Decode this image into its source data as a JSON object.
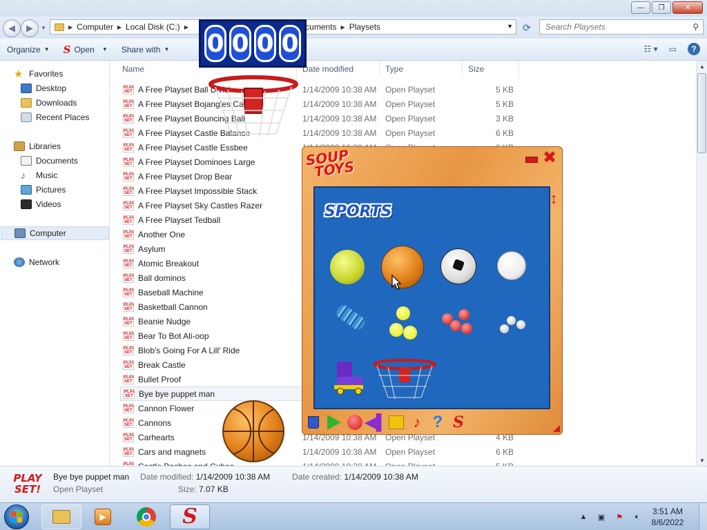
{
  "window": {
    "minimize_glyph": "—",
    "maximize_glyph": "❐",
    "close_glyph": "✕"
  },
  "address": {
    "back_glyph": "◀",
    "forward_glyph": "▶",
    "crumbs": [
      "Computer",
      "Local Disk (C:)",
      "Documents",
      "Playsets"
    ],
    "search_placeholder": "Search Playsets"
  },
  "toolbar": {
    "organize": "Organize",
    "open": "Open",
    "share_with": "Share with"
  },
  "nav": {
    "favorites": "Favorites",
    "desktop": "Desktop",
    "downloads": "Downloads",
    "recent_places": "Recent Places",
    "libraries": "Libraries",
    "documents": "Documents",
    "music": "Music",
    "pictures": "Pictures",
    "videos": "Videos",
    "computer": "Computer",
    "network": "Network"
  },
  "columns": {
    "name": "Name",
    "date": "Date modified",
    "type": "Type",
    "size": "Size"
  },
  "files": [
    {
      "name": "A Free Playset Ball Divisi",
      "date": "1/14/2009 10:38 AM",
      "type": "Open Playset",
      "size": "5 KB"
    },
    {
      "name": "A Free Playset Bojangles Castle",
      "date": "1/14/2009 10:38 AM",
      "type": "Open Playset",
      "size": "5 KB"
    },
    {
      "name": "A Free Playset Bouncing Ball",
      "date": "1/14/2009 10:38 AM",
      "type": "Open Playset",
      "size": "3 KB"
    },
    {
      "name": "A Free Playset Castle Balance",
      "date": "1/14/2009 10:38 AM",
      "type": "Open Playset",
      "size": "6 KB"
    },
    {
      "name": "A Free Playset Castle Essbee",
      "date": "1/14/2009 10:38 AM",
      "type": "Open Playset",
      "size": "6 KB"
    },
    {
      "name": "A Free Playset Dominoes Large",
      "date": "",
      "type": "",
      "size": ""
    },
    {
      "name": "A Free Playset Drop Bear",
      "date": "",
      "type": "",
      "size": ""
    },
    {
      "name": "A Free Playset Impossible Stack",
      "date": "",
      "type": "",
      "size": ""
    },
    {
      "name": "A Free Playset Sky Castles Razer",
      "date": "",
      "type": "",
      "size": ""
    },
    {
      "name": "A Free Playset Tedball",
      "date": "",
      "type": "",
      "size": ""
    },
    {
      "name": "Another One",
      "date": "",
      "type": "",
      "size": ""
    },
    {
      "name": "Asylum",
      "date": "",
      "type": "",
      "size": ""
    },
    {
      "name": "Atomic Breakout",
      "date": "",
      "type": "",
      "size": ""
    },
    {
      "name": "Ball dominos",
      "date": "",
      "type": "",
      "size": ""
    },
    {
      "name": "Baseball Machine",
      "date": "",
      "type": "",
      "size": ""
    },
    {
      "name": "Basketball Cannon",
      "date": "",
      "type": "",
      "size": ""
    },
    {
      "name": "Beanie Nudge",
      "date": "",
      "type": "",
      "size": ""
    },
    {
      "name": "Bear To Bot Ali-oop",
      "date": "",
      "type": "",
      "size": ""
    },
    {
      "name": "Blob's Going For A Lill' Ride",
      "date": "",
      "type": "",
      "size": ""
    },
    {
      "name": "Break Castle",
      "date": "",
      "type": "",
      "size": ""
    },
    {
      "name": "Bullet Proof",
      "date": "",
      "type": "",
      "size": ""
    },
    {
      "name": "Bye bye puppet man",
      "date": "",
      "type": "",
      "size": "",
      "selected": true
    },
    {
      "name": "Cannon Flower",
      "date": "",
      "type": "",
      "size": ""
    },
    {
      "name": "Cannons",
      "date": "",
      "type": "",
      "size": ""
    },
    {
      "name": "Carhearts",
      "date": "1/14/2009 10:38 AM",
      "type": "Open Playset",
      "size": "4 KB"
    },
    {
      "name": "Cars and magnets",
      "date": "1/14/2009 10:38 AM",
      "type": "Open Playset",
      "size": "6 KB"
    },
    {
      "name": "Castle Bashes and Cubes",
      "date": "1/14/2009 10:38 AM",
      "type": "Open Playset",
      "size": "5 KB"
    }
  ],
  "details": {
    "logo_line1": "PLAY",
    "logo_line2": "SET!",
    "name": "Bye bye puppet man",
    "type": "Open Playset",
    "modified_label": "Date modified:",
    "modified_value": "1/14/2009 10:38 AM",
    "created_label": "Date created:",
    "created_value": "1/14/2009 10:38 AM",
    "size_label": "Size:",
    "size_value": "7.07 KB"
  },
  "score": {
    "digits": [
      "0",
      "0",
      "0",
      "0"
    ]
  },
  "playset": {
    "logo_line1": "SOUP",
    "logo_line2": "TOYS",
    "category": "SPORTS",
    "items": [
      "tennis-ball",
      "basketball",
      "soccer-ball",
      "baseball",
      "spring",
      "yellow-balls",
      "red-balls",
      "white-balls",
      "roller-skate",
      "basketball-hoop"
    ],
    "tools": [
      "bucket-icon",
      "play-icon",
      "stop-icon",
      "rewind-icon",
      "square-icon",
      "music-icon",
      "help-icon",
      "soup-logo-icon"
    ]
  },
  "taskbar": {
    "time": "3:51 AM",
    "date": "8/6/2022"
  },
  "colors": {
    "accent_red": "#d81818",
    "canvas_blue": "#2068bd",
    "wood": "#e89644"
  }
}
